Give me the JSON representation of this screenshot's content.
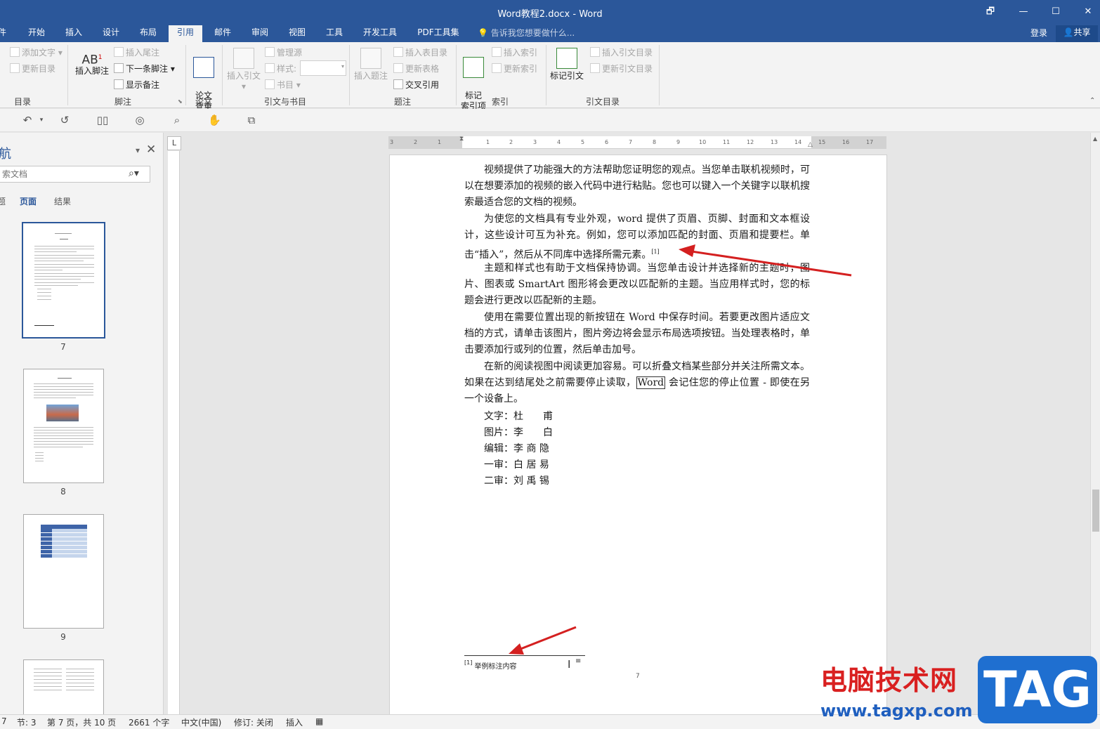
{
  "window": {
    "title": "Word教程2.docx - Word",
    "restore": "🗗",
    "minimize": "—",
    "maximize": "☐"
  },
  "tabs": [
    {
      "label": "件"
    },
    {
      "label": "开始"
    },
    {
      "label": "插入"
    },
    {
      "label": "设计"
    },
    {
      "label": "布局"
    },
    {
      "label": "引用"
    },
    {
      "label": "邮件"
    },
    {
      "label": "审阅"
    },
    {
      "label": "视图"
    },
    {
      "label": "工具"
    },
    {
      "label": "开发工具"
    },
    {
      "label": "PDF工具集"
    }
  ],
  "tellme": "告诉我您想要做什么...",
  "login": "登录",
  "share": "共享",
  "ribbon": {
    "toc": {
      "add_text": "添加文字",
      "update_toc": "更新目录",
      "group": "目录"
    },
    "footnotes": {
      "insert_footnote": "插入脚注",
      "insert_endnote": "插入尾注",
      "next_footnote": "下一条脚注",
      "show_notes": "显示备注",
      "group": "脚注"
    },
    "paper": {
      "check": "论文\n查重",
      "group": "论文"
    },
    "citations": {
      "insert_citation": "插入引文",
      "manage_sources": "管理源",
      "style_label": "样式:",
      "bibliography": "书目",
      "group": "引文与书目"
    },
    "captions": {
      "insert_caption": "插入题注",
      "insert_table_of_figures": "插入表目录",
      "update_table": "更新表格",
      "cross_reference": "交叉引用",
      "group": "题注"
    },
    "index": {
      "mark_entry": "标记\n索引项",
      "insert_index": "插入索引",
      "update_index": "更新索引",
      "group": "索引"
    },
    "authorities": {
      "mark_citation": "标记引文",
      "insert_table_of_authorities": "插入引文目录",
      "update_table_of_authorities": "更新引文目录",
      "group": "引文目录"
    }
  },
  "qat": {
    "undo": "↶",
    "redo": "↺"
  },
  "nav": {
    "title": "航",
    "search_placeholder": "索文档",
    "tabs": [
      {
        "label": "题"
      },
      {
        "label": "页面"
      },
      {
        "label": "结果"
      }
    ],
    "thumbnails": [
      {
        "num": "7"
      },
      {
        "num": "8"
      },
      {
        "num": "9"
      }
    ]
  },
  "ruler_labels": [
    "3",
    "2",
    "1",
    "1",
    "2",
    "3",
    "4",
    "5",
    "6",
    "7",
    "8",
    "9",
    "10",
    "11",
    "12",
    "13",
    "14",
    "15",
    "16",
    "17"
  ],
  "document": {
    "paragraphs": [
      "视频提供了功能强大的方法帮助您证明您的观点。当您单击联机视频时，可以在想要添加的视频的嵌入代码中进行粘贴。您也可以键入一个关键字以联机搜索最适合您的文档的视频。",
      "为使您的文档具有专业外观，word 提供了页眉、页脚、封面和文本框设计，这些设计可互为补充。例如，您可以添加匹配的封面、页眉和提要栏。单击“插入”，然后从不同库中选择所需元素。",
      "主题和样式也有助于文档保持协调。当您单击设计并选择新的主题时，图片、图表或 SmartArt 图形将会更改以匹配新的主题。当应用样式时，您的标题会进行更改以匹配新的主题。",
      "使用在需要位置出现的新按钮在 Word 中保存时间。若要更改图片适应文档的方式，请单击该图片，图片旁边将会显示布局选项按钮。当处理表格时，单击要添加行或列的位置，然后单击加号。",
      "在新的阅读视图中阅读更加容易。可以折叠文档某些部分并关注所需文本。如果在达到结尾处之前需要停止读取，",
      " 会记住您的停止位置 - 即使在另一个设备上。"
    ],
    "boxed_word": "Word",
    "footnote_ref": "[1]",
    "credits": [
      {
        "label": "文字：",
        "name": "杜　　甫"
      },
      {
        "label": "图片：",
        "name": "李　　白"
      },
      {
        "label": "编辑：",
        "name": "李 商 隐"
      },
      {
        "label": "一审：",
        "name": "白 居 易"
      },
      {
        "label": "二审：",
        "name": "刘 禹 锡"
      }
    ],
    "footnote": {
      "ref": "[1]",
      "text": "举例标注内容"
    },
    "page_number": "7"
  },
  "status": {
    "page_short": "7",
    "section": "节: 3",
    "page": "第 7 页，共 10 页",
    "words": "2661 个字",
    "language": "中文(中国)",
    "track": "修订: 关闭",
    "mode": "插入"
  },
  "watermark": {
    "cn": "电脑技术网",
    "url": "www.tagxp.com",
    "tag": "TAG"
  },
  "colors": {
    "brand": "#2b579a",
    "annotation": "#d42020"
  }
}
